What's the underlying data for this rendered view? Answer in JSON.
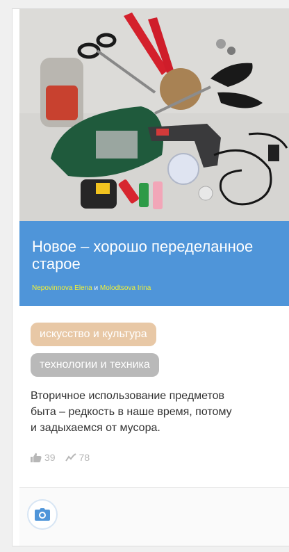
{
  "card": {
    "title": "Новое – хорошо переделанное старое",
    "authors": [
      {
        "name": "Nepovinnova Elena"
      },
      {
        "name": "Molodtsova Irina"
      }
    ],
    "authors_joiner": " и ",
    "tags": [
      {
        "label": "искусство и культура",
        "color": "#e8c8a6"
      },
      {
        "label": "технологии и техника",
        "color": "#b9b9b9"
      }
    ],
    "description_lines": [
      "Вторичное использование предметов",
      "быта – редкость в наше время, потому",
      "и задыхаемся от мусора."
    ],
    "stats": {
      "likes": "39",
      "views": "78"
    },
    "header_color": "#4f95d9",
    "author_link_color": "#f4f233",
    "icons": {
      "likes": "thumbs-up-icon",
      "views": "trend-icon",
      "camera": "camera-icon"
    }
  }
}
